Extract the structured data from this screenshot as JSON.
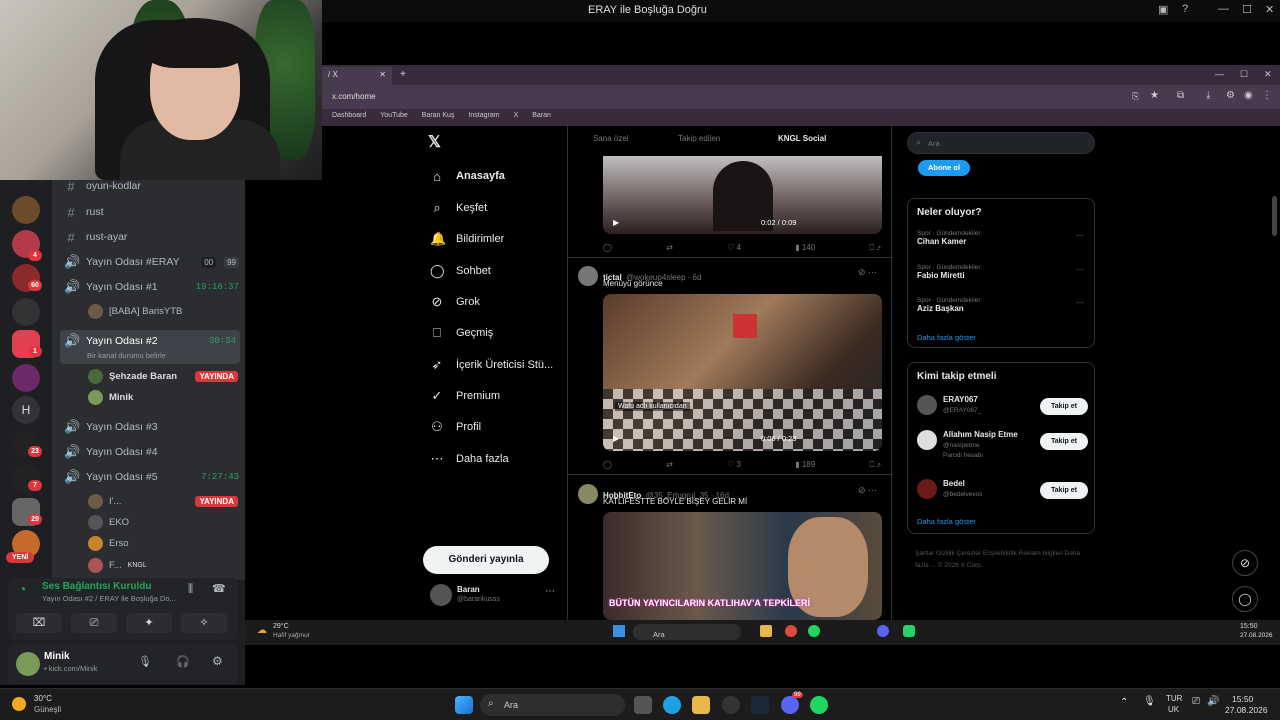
{
  "window": {
    "title": "ERAY ile Boşluğa Doğru"
  },
  "discord": {
    "guild_badges": [
      "4",
      "60",
      "1",
      "4",
      "23",
      "7",
      "29",
      "36"
    ],
    "guild_letter": "H",
    "new_badge": "YENİ",
    "channels": [
      {
        "name": "oyun-kodlar",
        "type": "text"
      },
      {
        "name": "rust",
        "type": "text"
      },
      {
        "name": "rust-ayar",
        "type": "text"
      },
      {
        "name": "Yayın Odası #ERAY",
        "type": "voice",
        "count_a": "00",
        "count_b": "99"
      },
      {
        "name": "Yayın Odası #1",
        "type": "voice",
        "timer": "19:16:37"
      },
      {
        "name": "Yayın Odası #2",
        "type": "voice",
        "timer": "30:34",
        "status": "Bir kanal durumu belirle"
      },
      {
        "name": "Yayın Odası #3",
        "type": "voice"
      },
      {
        "name": "Yayın Odası #4",
        "type": "voice"
      },
      {
        "name": "Yayın Odası #5",
        "type": "voice",
        "timer": "7:27:43"
      }
    ],
    "users_1": [
      {
        "name": "[BABA] BarisYTB"
      }
    ],
    "users_2": [
      {
        "name": "Şehzade Baran",
        "live": "YAYINDA"
      },
      {
        "name": "Minik"
      }
    ],
    "users_5": [
      {
        "name": "I'...",
        "live": "YAYINDA"
      },
      {
        "name": "EKO"
      },
      {
        "name": "Erso"
      },
      {
        "name": "F...",
        "tag": "KNGL"
      }
    ],
    "voice_status": "Ses Bağlantısı Kuruldu",
    "voice_sub": "Yayın Odası #2 / ERAY ile Boşluğa Do...",
    "user_name": "Minik",
    "user_sub": "• kick.com/Minik"
  },
  "browser": {
    "tab_title": "/ X",
    "url": "x.com/home",
    "bookmarks": [
      "Dashboard",
      "YouTube",
      "Baran Kuş",
      "Instagram",
      "X",
      "Baran"
    ]
  },
  "x": {
    "nav": [
      {
        "label": "Anasayfa",
        "icon": "home-icon"
      },
      {
        "label": "Keşfet",
        "icon": "search-icon"
      },
      {
        "label": "Bildirimler",
        "icon": "bell-icon"
      },
      {
        "label": "Sohbet",
        "icon": "chat-icon"
      },
      {
        "label": "Grok",
        "icon": "grok-icon"
      },
      {
        "label": "Geçmiş",
        "icon": "bookmark-icon"
      },
      {
        "label": "İçerik Üreticisi Stü...",
        "icon": "rocket-icon"
      },
      {
        "label": "Premium",
        "icon": "check-icon"
      },
      {
        "label": "Profil",
        "icon": "profile-icon"
      },
      {
        "label": "Daha fazla",
        "icon": "more-icon"
      }
    ],
    "post_button": "Gönderi yayınla",
    "account": {
      "name": "Baran",
      "handle": "@barankusss"
    },
    "feed_tabs": [
      "Sana özel",
      "Takip edilen",
      "KNGL Social"
    ],
    "video1": {
      "time": "0:02 / 0:09",
      "replies": "",
      "retweets": "",
      "likes": "4",
      "views": "140"
    },
    "tweet2": {
      "name": "tictal",
      "handle": "@wokeup4sleep · 6d",
      "text": "Menüyü görünce",
      "time": "0:06 / 0:23",
      "likes": "3",
      "views": "189",
      "caption": "Wafu adlı kullanıcıdan"
    },
    "tweet3": {
      "name": "HobbitEto",
      "handle": "@35_Ertugrul_35 · 16d",
      "text": "KATLIFESTTE BÖYLE BİŞEY GELİR Mİ",
      "caption": "BÜTÜN YAYINCILARIN KATLIHAV’A TEPKİLERİ"
    },
    "search_placeholder": "Ara",
    "subscribe": "Abone ol",
    "trends_title": "Neler oluyor?",
    "trends": [
      {
        "cat": "Spor · Gündemdekiler",
        "name": "Cihan Kamer"
      },
      {
        "cat": "Spor · Gündemdekiler",
        "name": "Fabio Miretti"
      },
      {
        "cat": "Spor · Gündemdekiler",
        "name": "Aziz Başkan"
      }
    ],
    "show_more": "Daha fazla göster",
    "who_title": "Kimi takip etmeli",
    "who": [
      {
        "name": "ERAY067",
        "handle": "@ERAY067_",
        "sub": ""
      },
      {
        "name": "Allahım Nasip Etme",
        "handle": "@nasipetme",
        "sub": "Parodi hesabı"
      },
      {
        "name": "Bedel",
        "handle": "@bedelvevos",
        "sub": ""
      }
    ],
    "follow_label": "Takip et",
    "footer": "Şartlar   Gizlilik   Çerezler   Erişilebilirlik   Reklam bilgileri   Daha fazla ...   © 2026 X Corp."
  },
  "inner_taskbar": {
    "weather_temp": "29°C",
    "weather_desc": "Hafif yağmur",
    "search": "Ara",
    "time": "15:50",
    "date": "27.08.2026"
  },
  "taskbar": {
    "weather_temp": "30°C",
    "weather_desc": "Güneşli",
    "search": "Ara",
    "lang1": "TUR",
    "lang2": "UK",
    "time": "15:50",
    "date": "27.08.2026",
    "steam_badge": "99"
  }
}
